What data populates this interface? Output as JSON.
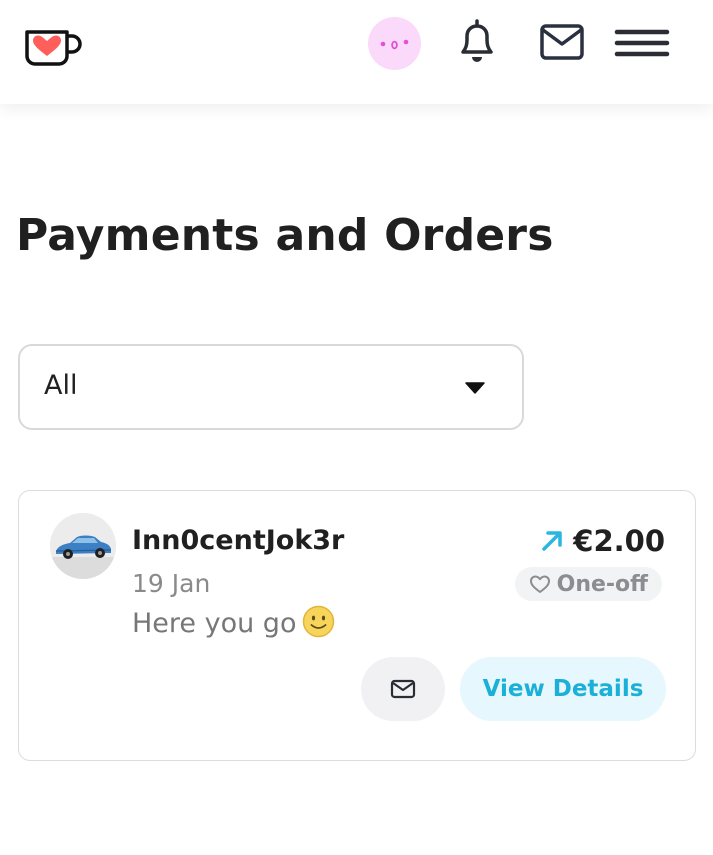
{
  "header": {
    "logo_icon": "heart-mug-logo",
    "avatar_icon": "face-avatar",
    "notification_icon": "bell-icon",
    "messages_icon": "envelope-icon",
    "menu_icon": "hamburger-menu-icon",
    "avatar_bg_color": "#fbd9fb",
    "logo_heart_color": "#ff5e5b"
  },
  "page": {
    "title": "Payments and Orders"
  },
  "filter": {
    "selected": "All"
  },
  "payments": [
    {
      "supporter_name": "Inn0centJok3r",
      "date": "19 Jan",
      "message": "Here you go",
      "message_emoji": "smiling-face-emoji",
      "amount": "€2.00",
      "direction_icon": "arrow-up-right-icon",
      "type_label": "One-off",
      "type_icon": "heart-outline-icon",
      "message_button_icon": "envelope-icon",
      "details_label": "View Details",
      "accent_color": "#1bb0d8"
    }
  ]
}
